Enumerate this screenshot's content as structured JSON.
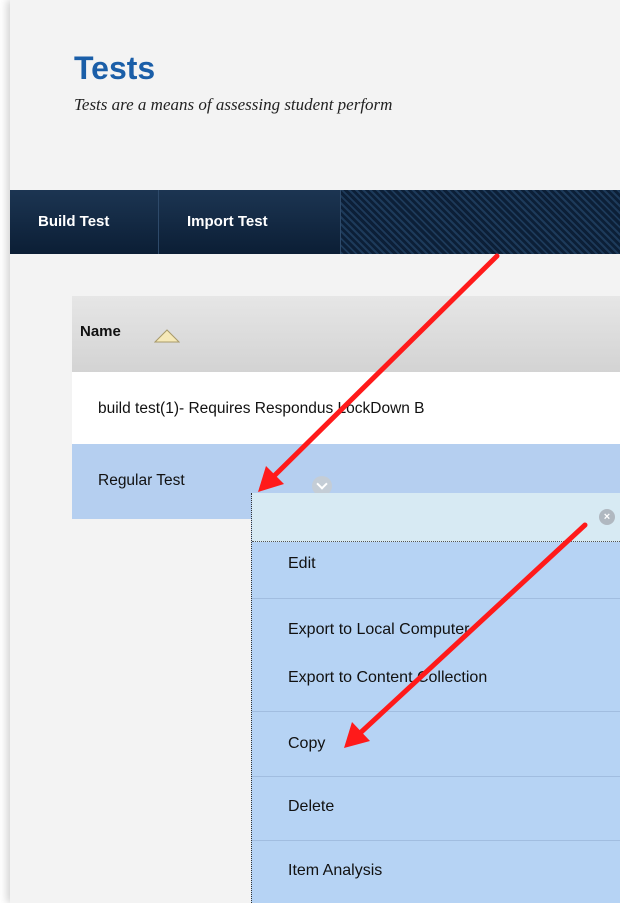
{
  "page": {
    "title": "Tests",
    "description": "Tests are a means of assessing student perform"
  },
  "action_bar": {
    "build_test": "Build Test",
    "import_test": "Import Test"
  },
  "table": {
    "column_name": "Name",
    "rows": [
      "build test(1)- Requires Respondus LockDown B",
      "Regular Test"
    ]
  },
  "context_menu": {
    "items": [
      "Edit",
      "Export to Local Computer",
      "Export to Content Collection",
      "Copy",
      "Delete",
      "Item Analysis"
    ]
  },
  "colors": {
    "title": "#1a5ea8",
    "action_bar": "#0b1e35",
    "selected_row": "#b5cff0",
    "menu": "#b6d3f4",
    "arrow": "#ff0000"
  },
  "icons": [
    "sort-ascending-icon",
    "chevron-down-icon",
    "close-icon"
  ]
}
